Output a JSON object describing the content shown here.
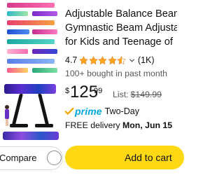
{
  "product": {
    "title_lines": [
      "Adjustable Balance Beam",
      "Gymnastic Beam Adjustab",
      "for Kids and Teenage of"
    ],
    "rating": "4.7",
    "stars_filled": 4.5,
    "reviews": "(1K)",
    "bought": "100+ bought in past month",
    "price": {
      "currency": "$",
      "whole": "125",
      "fraction": "99"
    },
    "list_price": {
      "label": "List:",
      "value": "$149.99"
    },
    "prime": {
      "label": "prime",
      "shipping": "Two-Day"
    },
    "delivery": {
      "prefix": "FREE delivery",
      "date": "Mon, Jun 15"
    }
  },
  "compare": {
    "label": "Compare"
  },
  "cart": {
    "label": "Add to cart"
  },
  "colors": {
    "star": "#ffa41c",
    "prime": "#00a8e1",
    "cart_button": "#ffd814"
  },
  "icons": [
    "star-icon",
    "chevron-down-icon",
    "prime-check-icon"
  ]
}
